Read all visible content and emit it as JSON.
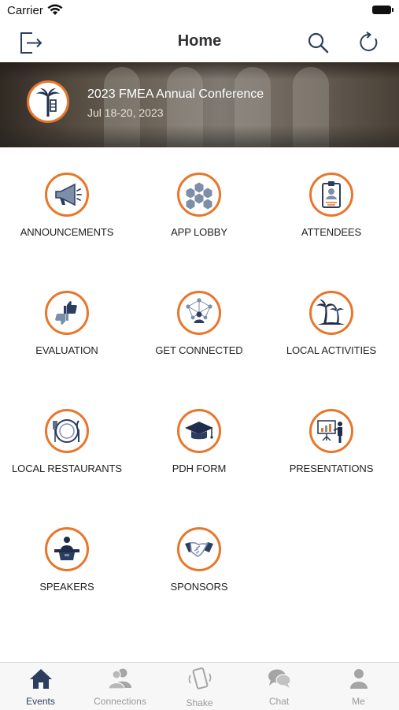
{
  "status_bar": {
    "carrier": "Carrier",
    "wifi_icon": "wifi-icon",
    "battery_icon": "battery-icon"
  },
  "nav": {
    "title": "Home",
    "left_icon": "exit-icon",
    "right_icons": [
      "search-icon",
      "refresh-icon"
    ]
  },
  "banner": {
    "title": "2023 FMEA Annual Conference",
    "date": "Jul 18-20, 2023",
    "logo_icon": "palm-tree-logo"
  },
  "tiles": [
    {
      "label": "ANNOUNCEMENTS",
      "icon": "megaphone-icon"
    },
    {
      "label": "APP LOBBY",
      "icon": "hexagon-grid-icon"
    },
    {
      "label": "ATTENDEES",
      "icon": "badge-icon"
    },
    {
      "label": "EVALUATION",
      "icon": "thumbs-icon"
    },
    {
      "label": "GET CONNECTED",
      "icon": "network-icon"
    },
    {
      "label": "LOCAL ACTIVITIES",
      "icon": "palm-trees-icon"
    },
    {
      "label": "LOCAL RESTAURANTS",
      "icon": "plate-icon"
    },
    {
      "label": "PDH FORM",
      "icon": "graduation-cap-icon"
    },
    {
      "label": "PRESENTATIONS",
      "icon": "presentation-icon"
    },
    {
      "label": "SPEAKERS",
      "icon": "podium-icon"
    },
    {
      "label": "SPONSORS",
      "icon": "handshake-icon"
    }
  ],
  "tabs": [
    {
      "label": "Events",
      "icon": "home-icon",
      "active": true
    },
    {
      "label": "Connections",
      "icon": "people-icon",
      "active": false
    },
    {
      "label": "Shake",
      "icon": "shake-phone-icon",
      "active": false
    },
    {
      "label": "Chat",
      "icon": "chat-icon",
      "active": false
    },
    {
      "label": "Me",
      "icon": "person-icon",
      "active": false
    }
  ],
  "colors": {
    "accent": "#e8762b",
    "icon_navy": "#2c3e60",
    "icon_slate": "#7d8ea8",
    "tab_inactive": "#9a9a9a"
  }
}
